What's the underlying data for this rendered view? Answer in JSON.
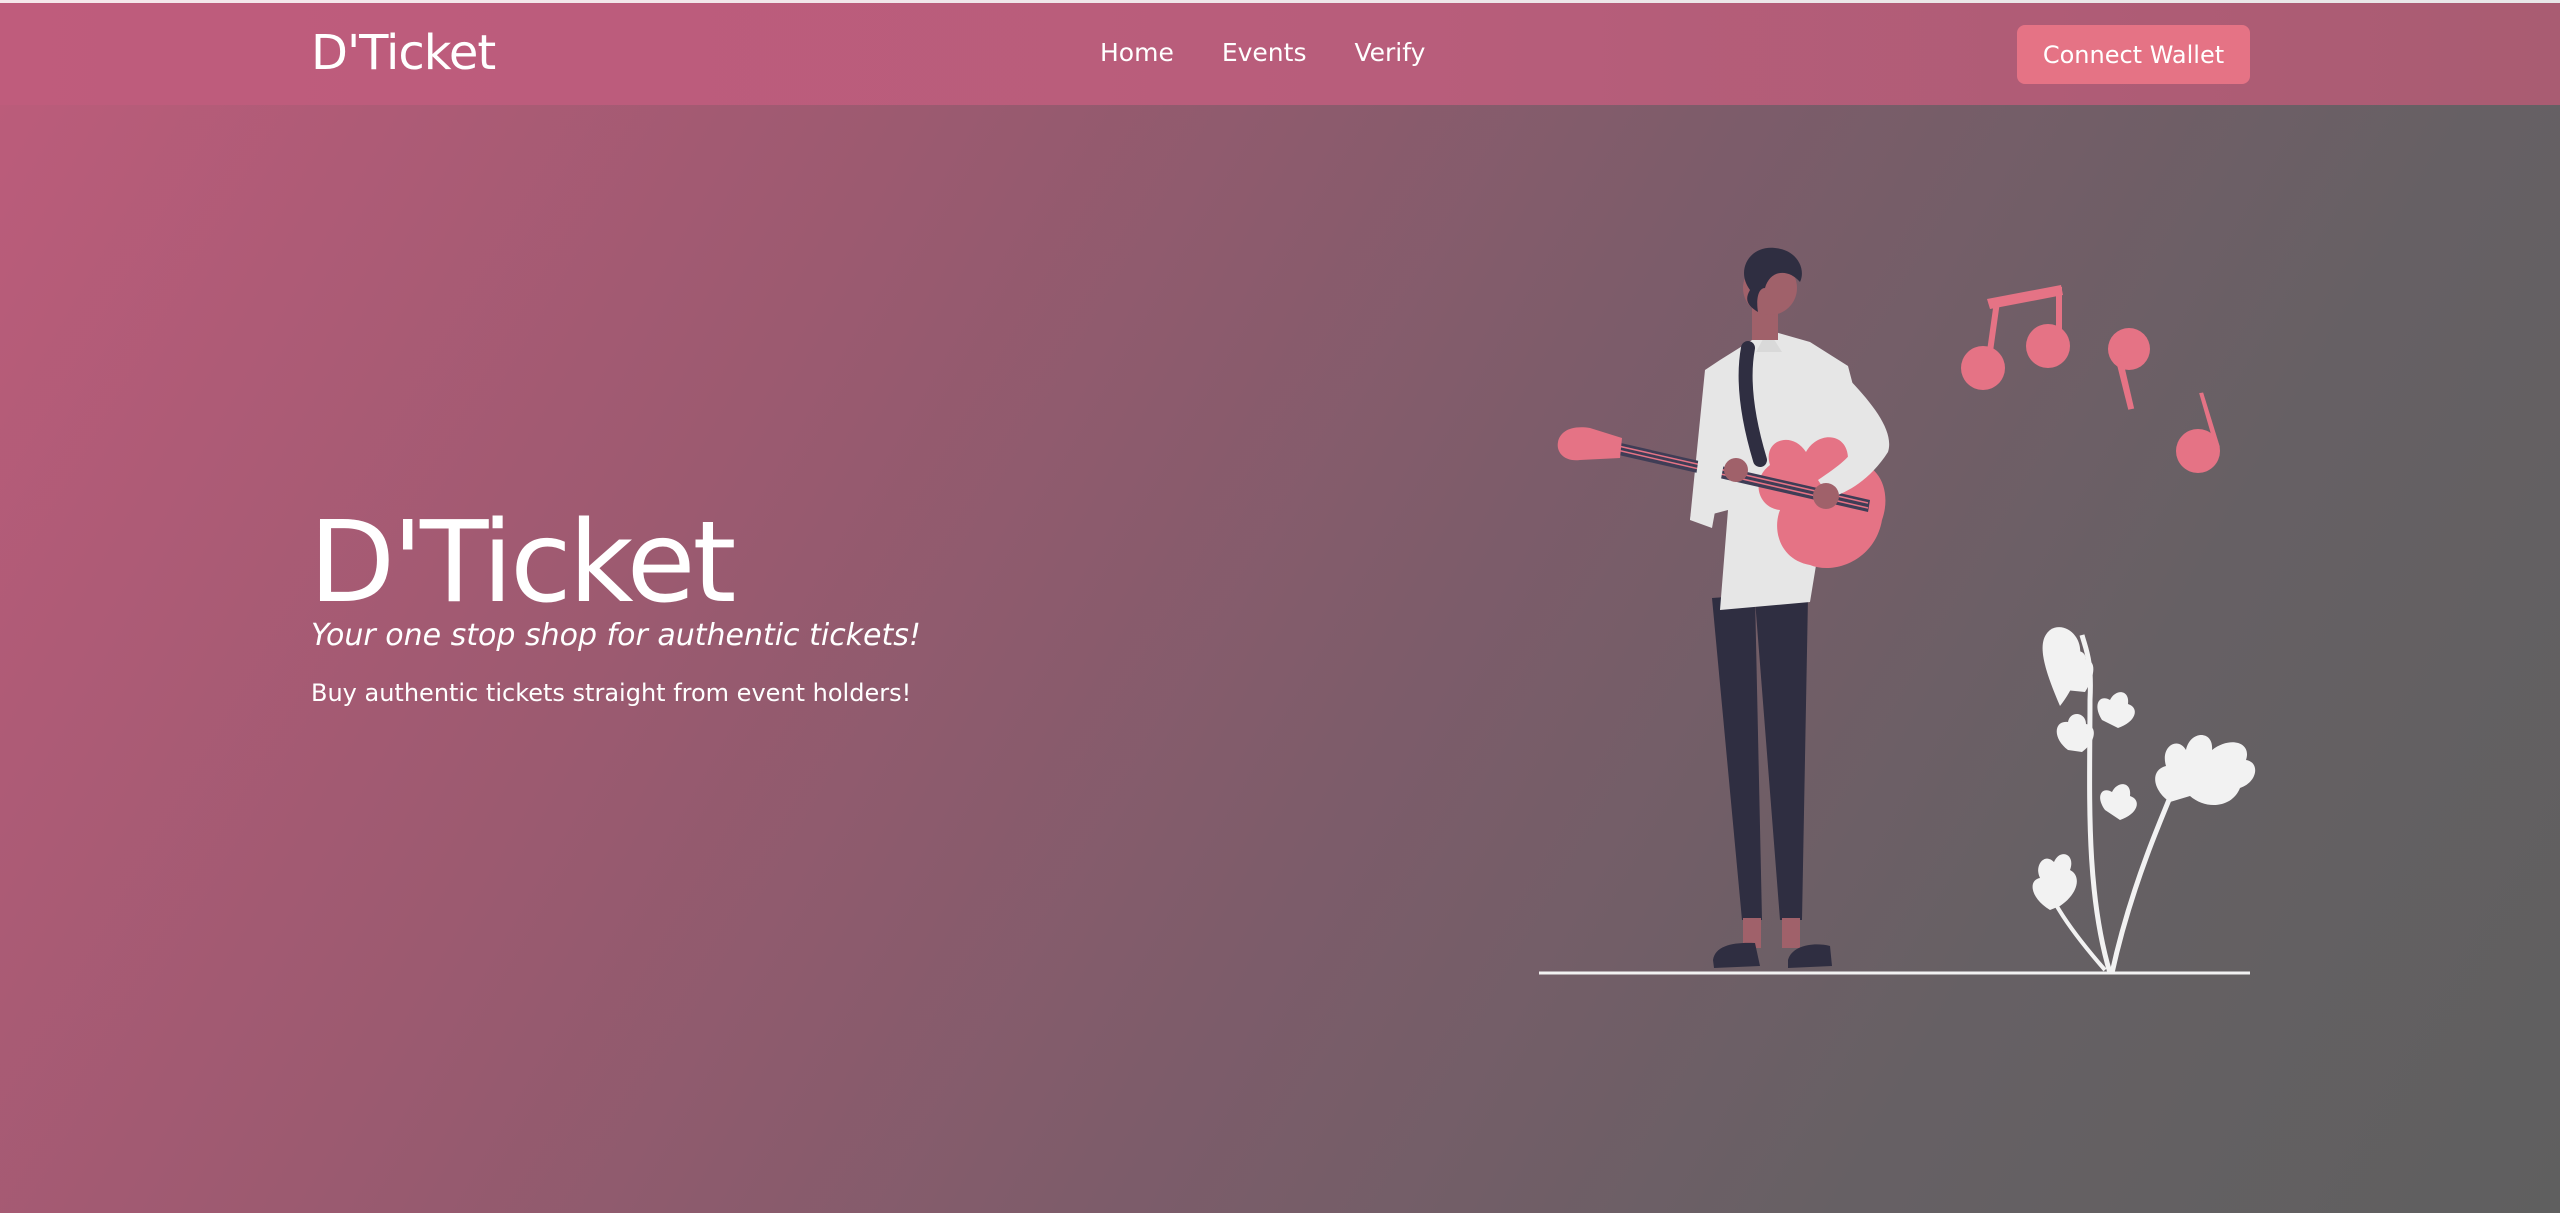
{
  "navbar": {
    "brand": "D'Ticket",
    "links": [
      {
        "label": "Home"
      },
      {
        "label": "Events"
      },
      {
        "label": "Verify"
      }
    ],
    "connect_button": "Connect Wallet"
  },
  "hero": {
    "title": "D'Ticket",
    "subtitle": "Your one stop shop for authentic tickets!",
    "description": "Buy authentic tickets straight from event holders!"
  },
  "illustration": {
    "icon": "musician-with-guitar-illustration"
  },
  "colors": {
    "navbar": "#bd5c7b",
    "accent": "#e57385",
    "gradient_start": "#bd5c7b",
    "gradient_end": "#5f5f5f",
    "figure_dark": "#2f2e41",
    "figure_shirt": "#e6e6e6"
  }
}
